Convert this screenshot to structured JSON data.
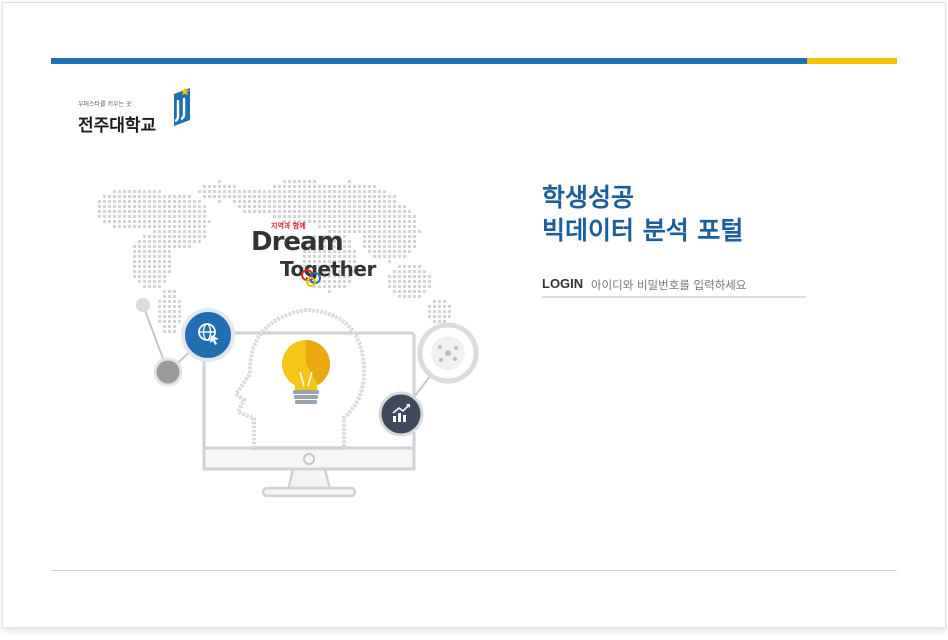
{
  "colors": {
    "brand_blue": "#1f6fb2",
    "brand_yellow": "#f2c400",
    "title_blue": "#1b5e9e",
    "icon_dark": "#3e4a5c",
    "icon_gray": "#8c8c8c"
  },
  "logo": {
    "slogan": "우퍼스타를 키우는 곳",
    "name": "전주대학교",
    "icon": "jj-star-emblem-icon"
  },
  "illustration": {
    "badge_small": "지역과 함께",
    "word_dream": "Dream",
    "word_together": "Together",
    "icons": [
      "globe-cursor-icon",
      "molecule-icon",
      "bar-chart-up-icon",
      "lightbulb-icon",
      "monitor-icon",
      "world-map-dots"
    ]
  },
  "portal": {
    "title_line1": "학생성공",
    "title_line2": "빅데이터 분석 포털"
  },
  "login": {
    "label": "LOGIN",
    "hint": "아이디와 비밀번호를 입력하세요"
  }
}
